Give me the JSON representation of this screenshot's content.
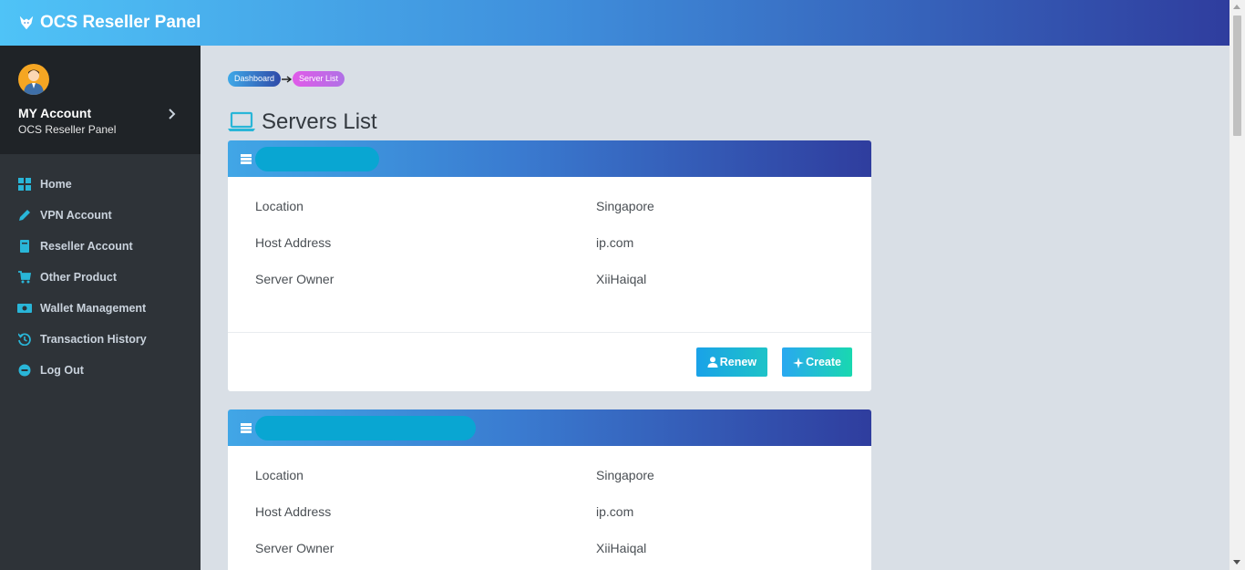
{
  "app": {
    "title": "OCS Reseller Panel"
  },
  "account": {
    "name": "MY Account",
    "subtitle": "OCS Reseller Panel"
  },
  "sidebar": {
    "items": [
      {
        "label": "Home",
        "icon": "home-grid-icon"
      },
      {
        "label": "VPN Account",
        "icon": "pencil-icon"
      },
      {
        "label": "Reseller Account",
        "icon": "book-icon"
      },
      {
        "label": "Other Product",
        "icon": "cart-icon"
      },
      {
        "label": "Wallet Management",
        "icon": "wallet-icon"
      },
      {
        "label": "Transaction History",
        "icon": "history-icon"
      },
      {
        "label": "Log Out",
        "icon": "minus-circle-icon"
      }
    ]
  },
  "breadcrumb": {
    "items": [
      "Dashboard",
      "Server List"
    ]
  },
  "page": {
    "title": "Servers List"
  },
  "servers": [
    {
      "fields": [
        {
          "label": "Location",
          "value": "Singapore"
        },
        {
          "label": "Host Address",
          "value": "ip.com"
        },
        {
          "label": "Server Owner",
          "value": "XiiHaiqal"
        }
      ],
      "actions": {
        "renew": "Renew",
        "create": "Create"
      }
    },
    {
      "fields": [
        {
          "label": "Location",
          "value": "Singapore"
        },
        {
          "label": "Host Address",
          "value": "ip.com"
        },
        {
          "label": "Server Owner",
          "value": "XiiHaiqal"
        }
      ]
    }
  ],
  "colors": {
    "header_start": "#4fc3f7",
    "header_end": "#2f3d9e",
    "sidebar_bg": "#2e3338",
    "nav_icon": "#29b6d8",
    "button_start": "#1aa2e8",
    "button_end": "#1ec3c8"
  }
}
